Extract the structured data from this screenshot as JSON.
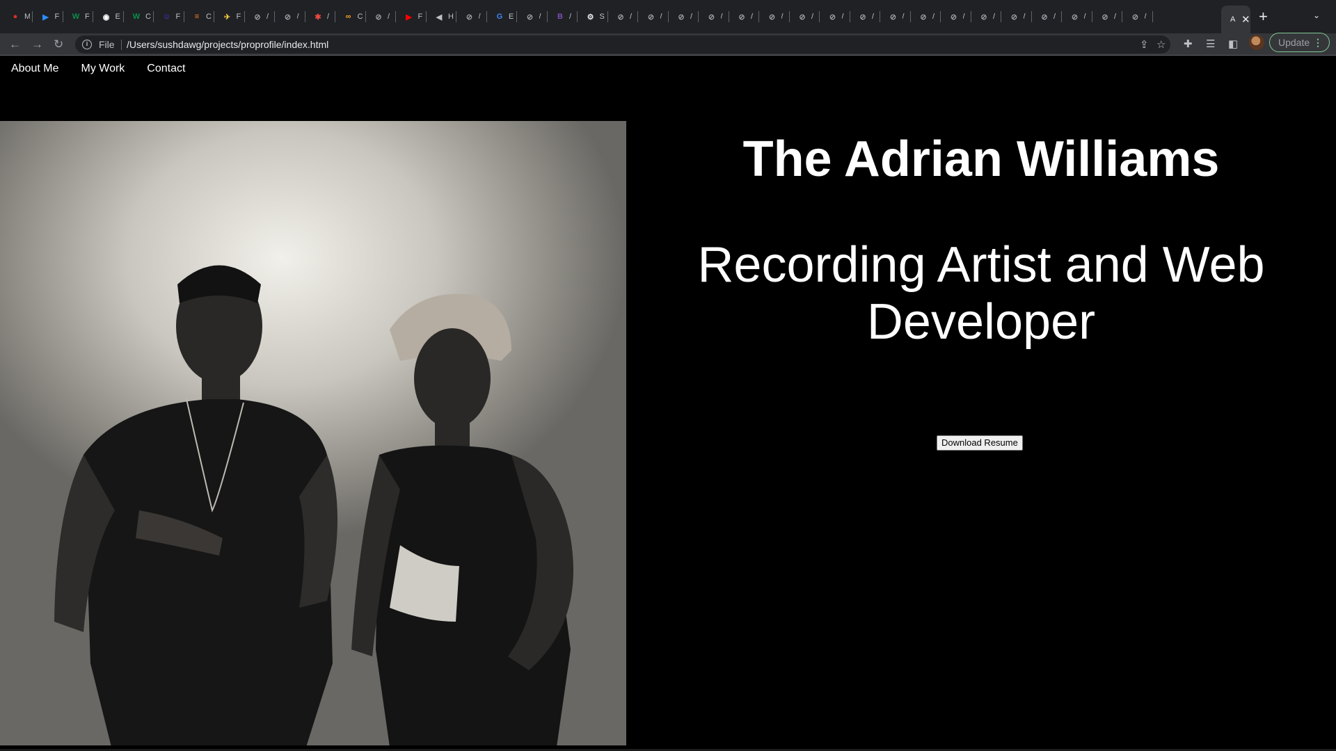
{
  "browser": {
    "tabs": [
      {
        "label": "M",
        "icon": "record-icon",
        "color": "#d93025",
        "glyph": "●"
      },
      {
        "label": "F",
        "icon": "zoom-icon",
        "color": "#2d8cff",
        "glyph": "▶"
      },
      {
        "label": "F",
        "icon": "w-icon",
        "color": "#0a8f4a",
        "glyph": "W"
      },
      {
        "label": "E",
        "icon": "github-icon",
        "color": "#ffffff",
        "glyph": "◉"
      },
      {
        "label": "C",
        "icon": "w-icon",
        "color": "#0a8f4a",
        "glyph": "W"
      },
      {
        "label": "F",
        "icon": "smiley-icon",
        "color": "#4a3aff",
        "glyph": "☺"
      },
      {
        "label": "C",
        "icon": "stack-icon",
        "color": "#f48024",
        "glyph": "≡"
      },
      {
        "label": "F",
        "icon": "plane-icon",
        "color": "#f2c744",
        "glyph": "✈"
      },
      {
        "label": "/",
        "icon": "globe-icon",
        "color": "#9aa0a6",
        "glyph": "⊘"
      },
      {
        "label": "/",
        "icon": "globe-icon",
        "color": "#9aa0a6",
        "glyph": "⊘"
      },
      {
        "label": "/",
        "icon": "asterisk-icon",
        "color": "#e8483f",
        "glyph": "✱"
      },
      {
        "label": "C",
        "icon": "infinity-icon",
        "color": "#f4a024",
        "glyph": "∞"
      },
      {
        "label": "/",
        "icon": "globe-icon",
        "color": "#9aa0a6",
        "glyph": "⊘"
      },
      {
        "label": "F",
        "icon": "youtube-icon",
        "color": "#ff0000",
        "glyph": "▶"
      },
      {
        "label": "H",
        "icon": "speaker-icon",
        "color": "#bdc1c6",
        "glyph": "◀"
      },
      {
        "label": "/",
        "icon": "globe-icon",
        "color": "#9aa0a6",
        "glyph": "⊘"
      },
      {
        "label": "E",
        "icon": "google-icon",
        "color": "#4285f4",
        "glyph": "G"
      },
      {
        "label": "/",
        "icon": "globe-icon",
        "color": "#9aa0a6",
        "glyph": "⊘"
      },
      {
        "label": "/",
        "icon": "bootstrap-icon",
        "color": "#7952b3",
        "glyph": "B"
      },
      {
        "label": "S",
        "icon": "gear-icon",
        "color": "#e8eaed",
        "glyph": "⚙"
      },
      {
        "label": "/",
        "icon": "globe-icon",
        "color": "#9aa0a6",
        "glyph": "⊘"
      },
      {
        "label": "/",
        "icon": "globe-icon",
        "color": "#9aa0a6",
        "glyph": "⊘"
      },
      {
        "label": "/",
        "icon": "globe-icon",
        "color": "#9aa0a6",
        "glyph": "⊘"
      },
      {
        "label": "/",
        "icon": "globe-icon",
        "color": "#9aa0a6",
        "glyph": "⊘"
      },
      {
        "label": "/",
        "icon": "globe-icon",
        "color": "#9aa0a6",
        "glyph": "⊘"
      },
      {
        "label": "/",
        "icon": "globe-icon",
        "color": "#9aa0a6",
        "glyph": "⊘"
      },
      {
        "label": "/",
        "icon": "globe-icon",
        "color": "#9aa0a6",
        "glyph": "⊘"
      },
      {
        "label": "/",
        "icon": "globe-icon",
        "color": "#9aa0a6",
        "glyph": "⊘"
      },
      {
        "label": "/",
        "icon": "globe-icon",
        "color": "#9aa0a6",
        "glyph": "⊘"
      },
      {
        "label": "/",
        "icon": "globe-icon",
        "color": "#9aa0a6",
        "glyph": "⊘"
      },
      {
        "label": "/",
        "icon": "globe-icon",
        "color": "#9aa0a6",
        "glyph": "⊘"
      },
      {
        "label": "/",
        "icon": "globe-icon",
        "color": "#9aa0a6",
        "glyph": "⊘"
      },
      {
        "label": "/",
        "icon": "globe-icon",
        "color": "#9aa0a6",
        "glyph": "⊘"
      },
      {
        "label": "/",
        "icon": "globe-icon",
        "color": "#9aa0a6",
        "glyph": "⊘"
      },
      {
        "label": "/",
        "icon": "globe-icon",
        "color": "#9aa0a6",
        "glyph": "⊘"
      },
      {
        "label": "/",
        "icon": "globe-icon",
        "color": "#9aa0a6",
        "glyph": "⊘"
      },
      {
        "label": "/",
        "icon": "globe-icon",
        "color": "#9aa0a6",
        "glyph": "⊘"
      },
      {
        "label": "/",
        "icon": "globe-icon",
        "color": "#9aa0a6",
        "glyph": "⊘"
      }
    ],
    "active_tab": {
      "label": "A",
      "icon": "close-icon"
    },
    "new_tab_icon": "plus-icon",
    "scheme_label": "File",
    "url": "/Users/sushdawg/projects/proprofile/index.html",
    "update_label": "Update"
  },
  "nav": {
    "items": [
      "About Me",
      "My Work",
      "Contact"
    ]
  },
  "hero": {
    "title": "The Adrian Williams",
    "subtitle_line1": "Recording Artist and Web",
    "subtitle_line2": "Developer",
    "button_label": "Download Resume"
  }
}
